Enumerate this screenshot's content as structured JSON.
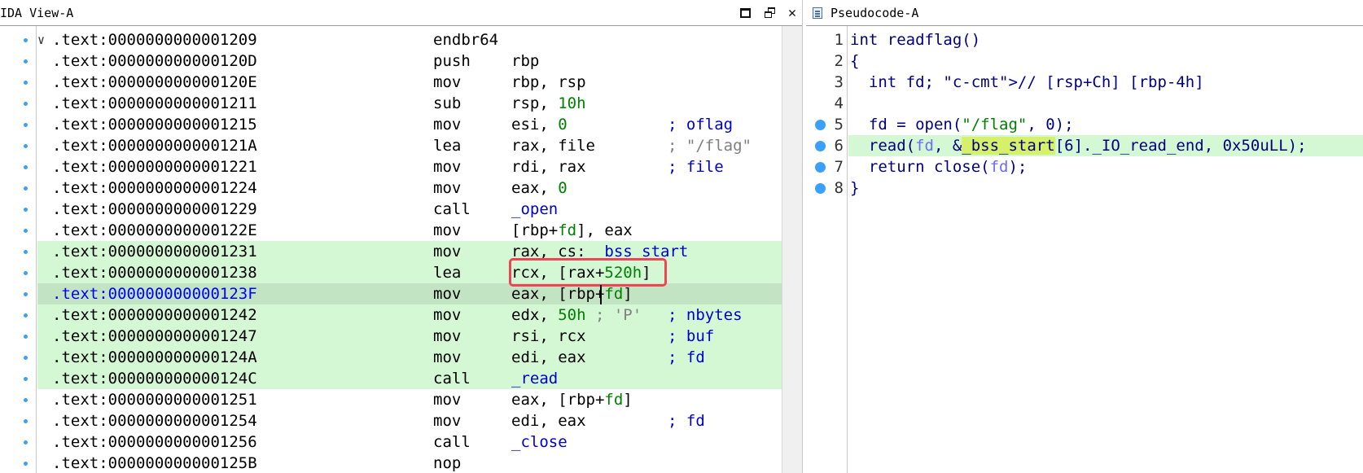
{
  "ida_view": {
    "title": "IDA View-A",
    "lines": [
      {
        "addr": ".text:0000000000001209",
        "mnem": "endbr64",
        "ops": "",
        "cmt": "",
        "fold": true,
        "state": "normal"
      },
      {
        "addr": ".text:000000000000120D",
        "mnem": "push",
        "ops": "rbp",
        "cmt": "",
        "state": "normal"
      },
      {
        "addr": ".text:000000000000120E",
        "mnem": "mov",
        "ops": "rbp, rsp",
        "cmt": "",
        "state": "normal"
      },
      {
        "addr": ".text:0000000000001211",
        "mnem": "sub",
        "ops": "rsp, 10h",
        "cmt": "",
        "state": "normal"
      },
      {
        "addr": ".text:0000000000001215",
        "mnem": "mov",
        "ops": "esi, 0",
        "cmt": "; oflag",
        "state": "normal"
      },
      {
        "addr": ".text:000000000000121A",
        "mnem": "lea",
        "ops": "rax, file",
        "cmt": "; \"/flag\"",
        "state": "normal"
      },
      {
        "addr": ".text:0000000000001221",
        "mnem": "mov",
        "ops": "rdi, rax",
        "cmt": "; file",
        "state": "normal"
      },
      {
        "addr": ".text:0000000000001224",
        "mnem": "mov",
        "ops": "eax, 0",
        "cmt": "",
        "state": "normal"
      },
      {
        "addr": ".text:0000000000001229",
        "mnem": "call",
        "ops": "_open",
        "cmt": "",
        "state": "normal"
      },
      {
        "addr": ".text:000000000000122E",
        "mnem": "mov",
        "ops": "[rbp+fd], eax",
        "cmt": "",
        "state": "normal"
      },
      {
        "addr": ".text:0000000000001231",
        "mnem": "mov",
        "ops": "rax, cs:__bss_start",
        "cmt": "",
        "state": "green"
      },
      {
        "addr": ".text:0000000000001238",
        "mnem": "lea",
        "ops": "rcx, [rax+520h]",
        "cmt": "",
        "state": "green"
      },
      {
        "addr": ".text:000000000000123F",
        "mnem": "mov",
        "ops": "eax, [rbp+fd]",
        "cmt": "",
        "state": "cur"
      },
      {
        "addr": ".text:0000000000001242",
        "mnem": "mov",
        "ops": "edx, 50h ; 'P'",
        "cmt": "; nbytes",
        "state": "green"
      },
      {
        "addr": ".text:0000000000001247",
        "mnem": "mov",
        "ops": "rsi, rcx",
        "cmt": "; buf",
        "state": "green"
      },
      {
        "addr": ".text:000000000000124A",
        "mnem": "mov",
        "ops": "edi, eax",
        "cmt": "; fd",
        "state": "green"
      },
      {
        "addr": ".text:000000000000124C",
        "mnem": "call",
        "ops": "_read",
        "cmt": "",
        "state": "green"
      },
      {
        "addr": ".text:0000000000001251",
        "mnem": "mov",
        "ops": "eax, [rbp+fd]",
        "cmt": "",
        "state": "normal"
      },
      {
        "addr": ".text:0000000000001254",
        "mnem": "mov",
        "ops": "edi, eax",
        "cmt": "; fd",
        "state": "normal"
      },
      {
        "addr": ".text:0000000000001256",
        "mnem": "call",
        "ops": "_close",
        "cmt": "",
        "state": "normal"
      },
      {
        "addr": ".text:000000000000125B",
        "mnem": "nop",
        "ops": "",
        "cmt": "",
        "state": "normal"
      }
    ]
  },
  "pseudocode": {
    "title": "Pseudocode-A",
    "lines": [
      {
        "num": "1",
        "dot": false,
        "state": "normal",
        "text": "int readflag()"
      },
      {
        "num": "2",
        "dot": false,
        "state": "normal",
        "text": "{"
      },
      {
        "num": "3",
        "dot": false,
        "state": "normal",
        "text": "  int fd; // [rsp+Ch] [rbp-4h]"
      },
      {
        "num": "4",
        "dot": false,
        "state": "normal",
        "text": ""
      },
      {
        "num": "5",
        "dot": true,
        "state": "normal",
        "text": "  fd = open(\"/flag\", 0);"
      },
      {
        "num": "6",
        "dot": true,
        "state": "green",
        "text": "  read(fd, &_bss_start[6]._IO_read_end, 0x50uLL);"
      },
      {
        "num": "7",
        "dot": true,
        "state": "normal",
        "text": "  return close(fd);"
      },
      {
        "num": "8",
        "dot": true,
        "state": "normal",
        "text": "}"
      }
    ]
  }
}
